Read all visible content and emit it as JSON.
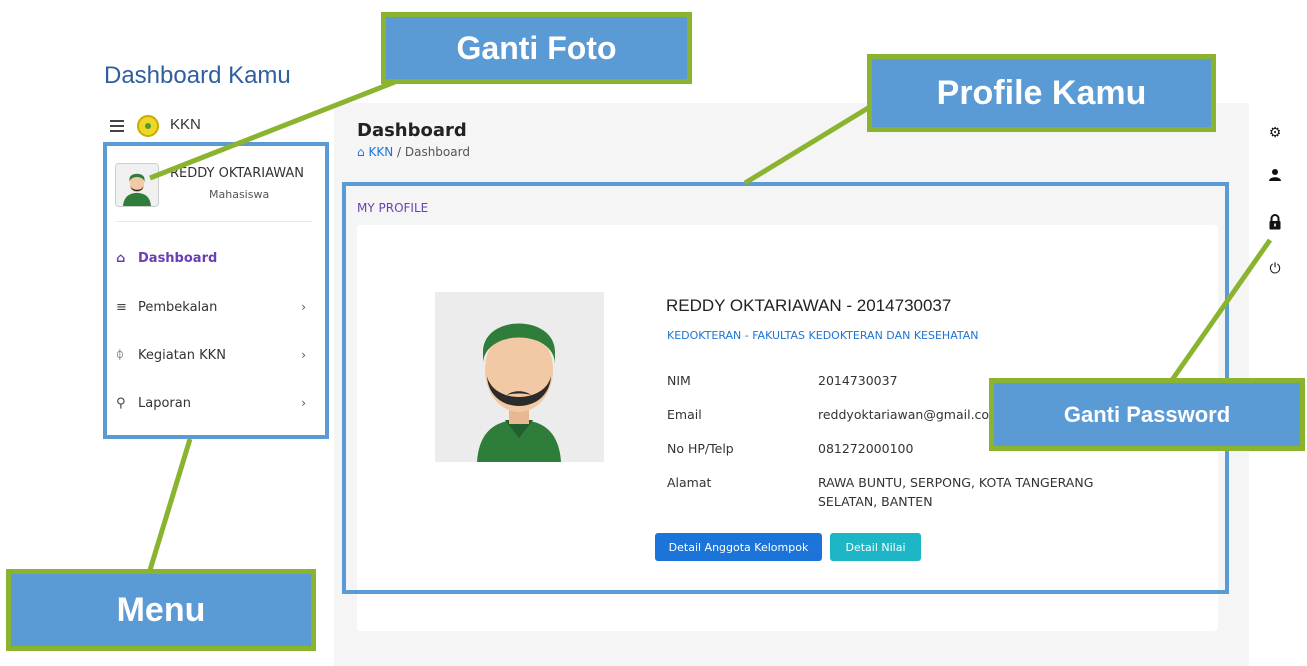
{
  "doc_title": "Dashboard Kamu",
  "nav": {
    "brand": "KKN"
  },
  "user": {
    "name": "REDDY OKTARIAWAN",
    "role": "Mahasiswa"
  },
  "menu": [
    {
      "label": "Dashboard",
      "icon": "home-icon",
      "active": true,
      "has_submenu": false
    },
    {
      "label": "Pembekalan",
      "icon": "layers-icon",
      "active": false,
      "has_submenu": true
    },
    {
      "label": "Kegiatan KKN",
      "icon": "activity-icon",
      "active": false,
      "has_submenu": true
    },
    {
      "label": "Laporan",
      "icon": "report-icon",
      "active": false,
      "has_submenu": true
    }
  ],
  "page": {
    "title": "Dashboard",
    "breadcrumb": [
      "KKN",
      "Dashboard"
    ]
  },
  "profile": {
    "section_label": "MY PROFILE",
    "heading": "REDDY OKTARIAWAN - 2014730037",
    "faculty": "KEDOKTERAN - FAKULTAS KEDOKTERAN DAN KESEHATAN",
    "fields": [
      {
        "label": "NIM",
        "value": "2014730037"
      },
      {
        "label": "Email",
        "value": "reddyoktariawan@gmail.com"
      },
      {
        "label": "No HP/Telp",
        "value": "081272000100"
      },
      {
        "label": "Alamat",
        "value": "RAWA BUNTU, SERPONG, KOTA TANGERANG SELATAN, BANTEN"
      }
    ],
    "buttons": {
      "group": "Detail Anggota Kelompok",
      "grades": "Detail Nilai"
    }
  },
  "toolbar": [
    "settings-icon",
    "user-icon",
    "lock-icon",
    "power-icon"
  ],
  "annotations": {
    "ganti_foto": "Ganti Foto",
    "profile_kamu": "Profile Kamu",
    "ganti_password": "Ganti Password",
    "menu": "Menu"
  },
  "colors": {
    "accent_purple": "#6a3fb3",
    "primary_blue": "#1c74d8",
    "teal": "#1cb6c6",
    "annotation_fill": "#5b9bd5",
    "annotation_border": "#8ab42f"
  }
}
